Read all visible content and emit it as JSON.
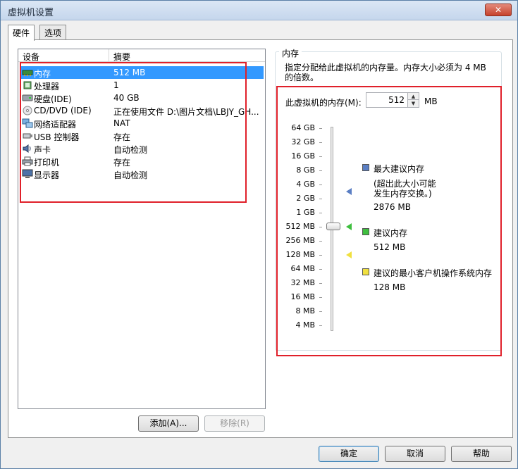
{
  "window": {
    "title": "虚拟机设置",
    "close": "✕"
  },
  "tabs": [
    {
      "label": "硬件",
      "active": true
    },
    {
      "label": "选项",
      "active": false
    }
  ],
  "device_list": {
    "columns": [
      "设备",
      "摘要"
    ],
    "rows": [
      {
        "name": "内存",
        "summary": "512 MB",
        "icon": "memory-icon",
        "selected": true
      },
      {
        "name": "处理器",
        "summary": "1",
        "icon": "processor-icon"
      },
      {
        "name": "硬盘(IDE)",
        "summary": "40 GB",
        "icon": "hard-disk-icon"
      },
      {
        "name": "CD/DVD (IDE)",
        "summary": "正在使用文件 D:\\图片文档\\LBJY_GH...",
        "icon": "cd-dvd-icon"
      },
      {
        "name": "网络适配器",
        "summary": "NAT",
        "icon": "network-adapter-icon"
      },
      {
        "name": "USB 控制器",
        "summary": "存在",
        "icon": "usb-icon"
      },
      {
        "name": "声卡",
        "summary": "自动检测",
        "icon": "sound-card-icon"
      },
      {
        "name": "打印机",
        "summary": "存在",
        "icon": "printer-icon"
      },
      {
        "name": "显示器",
        "summary": "自动检测",
        "icon": "display-icon"
      }
    ]
  },
  "buttons": {
    "add": "添加(A)...",
    "remove": "移除(R)",
    "ok": "确定",
    "cancel": "取消",
    "help": "帮助"
  },
  "memory": {
    "group_label": "内存",
    "description": "指定分配给此虚拟机的内存量。内存大小必须为 4 MB 的倍数。",
    "field_label": "此虚拟机的内存(M):",
    "value": "512",
    "unit": "MB",
    "scale_labels": [
      "64 GB",
      "32 GB",
      "16 GB",
      "8 GB",
      "4 GB",
      "2 GB",
      "1 GB",
      "512 MB",
      "256 MB",
      "128 MB",
      "64 MB",
      "32 MB",
      "16 MB",
      "8 MB",
      "4 MB"
    ],
    "legend": {
      "max": {
        "label": "最大建议内存",
        "note_line1": "(超出此大小可能",
        "note_line2": "发生内存交换。)",
        "value": "2876 MB",
        "color": "#5b7fc4"
      },
      "recommended": {
        "label": "建议内存",
        "value": "512 MB",
        "color": "#3fbf3f"
      },
      "min": {
        "label": "建议的最小客户机操作系统内存",
        "value": "128 MB",
        "color": "#f0e040"
      }
    }
  },
  "colors": {
    "highlight": "#3399ff",
    "annotation": "#e0202a"
  }
}
